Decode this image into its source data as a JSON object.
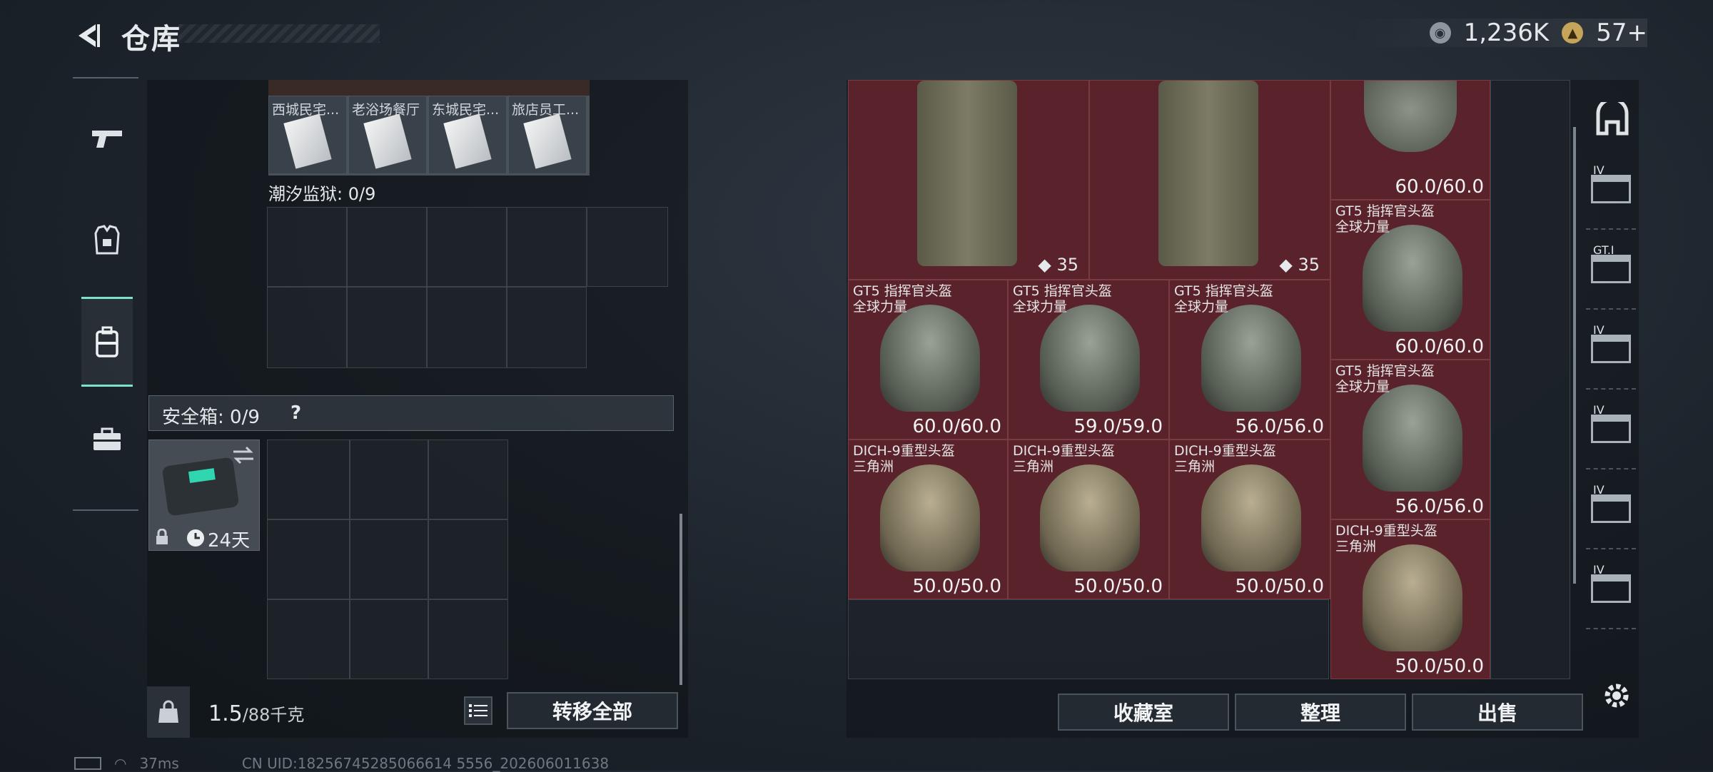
{
  "header": {
    "title": "仓库"
  },
  "currency": {
    "coins": "1,236K",
    "tickets": "57+"
  },
  "left_nav": {
    "items": [
      "weapons",
      "armor",
      "backpack",
      "toolbox"
    ],
    "active": "backpack"
  },
  "backpack": {
    "top_items": [
      "西城民宅...",
      "老浴场餐厅",
      "东城民宅...",
      "旅店员工..."
    ],
    "section_label": "潮汐监狱: 0/9",
    "safe_box_label": "安全箱: 0/9",
    "safe_help": "?",
    "safe_box_timer": "24天",
    "weight_current": "1.5",
    "weight_max": "/88千克",
    "transfer_all": "转移全部"
  },
  "stash": {
    "backpacks": [
      {
        "count": "35"
      },
      {
        "count": "35"
      }
    ],
    "items": [
      {
        "name": "GT5 指挥官头盔",
        "sub": "全球力量",
        "dur": "60.0/60.0"
      },
      {
        "name": "GT5 指挥官头盔",
        "sub": "全球力量",
        "dur": "60.0/60.0"
      },
      {
        "name": "GT5 指挥官头盔",
        "sub": "全球力量",
        "dur": "59.0/59.0"
      },
      {
        "name": "GT5 指挥官头盔",
        "sub": "全球力量",
        "dur": "56.0/56.0"
      },
      {
        "name": "GT5 指挥官头盔",
        "sub": "全球力量",
        "dur": "60.0/60.0"
      },
      {
        "name": "GT5 指挥官头盔",
        "sub": "全球力量",
        "dur": "56.0/56.0"
      },
      {
        "name": "DICH-9重型头盔",
        "sub": "三角洲",
        "dur": "50.0/50.0"
      },
      {
        "name": "DICH-9重型头盔",
        "sub": "三角洲",
        "dur": "50.0/50.0"
      },
      {
        "name": "DICH-9重型头盔",
        "sub": "三角洲",
        "dur": "50.0/50.0"
      },
      {
        "name": "DICH-9重型头盔",
        "sub": "三角洲",
        "dur": "50.0/50.0"
      }
    ],
    "top_helmet_dur": "60.0/60.0",
    "buttons": {
      "collection": "收藏室",
      "organize": "整理",
      "sell": "出售"
    }
  },
  "right_tabs": [
    "IV",
    "GT.I",
    "IV",
    "IV",
    "IV",
    "IV"
  ],
  "status": {
    "ping": "37ms",
    "uid": "CN UID:18256745285066614 5556_202606011638"
  },
  "colors": {
    "accent": "#7de3c6",
    "equip_bg": "#5a232b"
  }
}
